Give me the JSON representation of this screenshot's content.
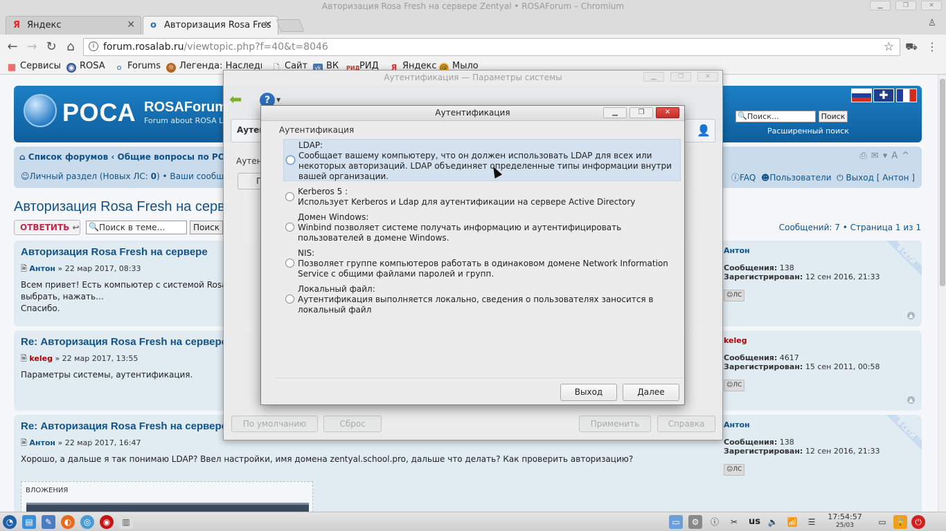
{
  "window": {
    "title": "Авторизация Rosa Fresh на сервере Zentyal • ROSAForum – Chromium"
  },
  "tabs": [
    {
      "label": "Яндекс",
      "favicon": "Я"
    },
    {
      "label": "Авторизация Rosa Fres",
      "favicon": "o"
    }
  ],
  "address": {
    "host": "forum.rosalab.ru",
    "path": "/viewtopic.php?f=40&t=8046"
  },
  "bookmarks": [
    {
      "label": "Сервисы",
      "icon": "apps-grid-icon"
    },
    {
      "label": "ROSA",
      "icon": "rosa-icon"
    },
    {
      "label": "Forums",
      "icon": "forums-icon"
    },
    {
      "label": "Легенда: Наследие",
      "icon": "game-icon"
    },
    {
      "label": "Сайт",
      "icon": "page-icon"
    },
    {
      "label": "ВК",
      "icon": "vk-icon"
    },
    {
      "label": "РИД",
      "icon": "rid-icon"
    },
    {
      "label": "Яндекс",
      "icon": "yandex-icon"
    },
    {
      "label": "Мыло",
      "icon": "mail-icon"
    }
  ],
  "forum": {
    "logo_text": "РОСА",
    "site_title": "ROSAForum",
    "site_desc": "Forum about ROSA L",
    "search_placeholder": "Поиск…",
    "search_button": "Поиск",
    "advanced_search": "Расширенный поиск",
    "breadcrumb_home": "Список форумов",
    "breadcrumb_sep": "‹",
    "breadcrumb_section": "Общие вопросы по РОСЕ",
    "personal_label": "Личный раздел (Новых ЛС: ",
    "personal_count": "0",
    "personal_close": ") • Ваши сообщен",
    "faq": "FAQ",
    "users": "Пользователи",
    "logout": "Выход [ Антон ]",
    "topic_title": "Авторизация Rosa Fresh на серве",
    "reply_button": "ОТВЕТИТЬ",
    "topic_search_placeholder": "Поиск в теме…",
    "topic_search_button": "Поиск",
    "pagination": "Сообщений: 7 • Страница 1 из 1",
    "attachments_label": "ВЛОЖЕНИЯ"
  },
  "posts": [
    {
      "title": "Авторизация Rosa Fresh на сервере",
      "author": "Антон",
      "date": " » 22 мар 2017, 08:33",
      "body": [
        "Всем привет! Есть компьютер с системой Rosa F",
        "выбрать, нажать…",
        "Спасибо."
      ],
      "profile_name": "Антон",
      "posts_label": "Сообщения:",
      "posts_count": "138",
      "reg_label": "Зарегистрирован:",
      "reg_date": "12 сен 2016, 21:33",
      "pm": "ЛС",
      "online": "В СЕТИ"
    },
    {
      "title": "Re: Авторизация Rosa Fresh на сервере",
      "author": "keleg",
      "date": " » 22 мар 2017, 13:55",
      "body": [
        "Параметры системы, аутентификация."
      ],
      "profile_name": "keleg",
      "posts_label": "Сообщения:",
      "posts_count": "4617",
      "reg_label": "Зарегистрирован:",
      "reg_date": "15 сен 2011, 00:58",
      "pm": "ЛС"
    },
    {
      "title": "Re: Авторизация Rosa Fresh на сервере",
      "author": "Антон",
      "date": " » 22 мар 2017, 16:47",
      "body": [
        "Хорошо, а дальше я так понимаю LDAP? Ввел настройки, имя домена zentyal.school.pro, дальше что делать? Как проверить авторизацию?"
      ],
      "profile_name": "Антон",
      "posts_label": "Сообщения:",
      "posts_count": "138",
      "reg_label": "Зарегистрирован:",
      "reg_date": "12 сен 2016, 21:33",
      "pm": "ЛС",
      "online": "В СЕТИ"
    }
  ],
  "parent_dialog": {
    "title": "Аутентификация — Параметры системы",
    "group_title": "Аутен",
    "section2": "Аутен",
    "section2_button": "П",
    "defaults_button": "По умолчанию",
    "reset_button": "Сброс",
    "apply_button": "Применить",
    "help_button": "Справка"
  },
  "auth_dialog": {
    "title": "Аутентификация",
    "group_label": "Аутентификация",
    "options": [
      {
        "title": "LDAP:",
        "desc": [
          "Сообщает вашему компьютеру, что он должен использовать LDAP для всех или",
          "некоторых авторизаций. LDAP объединяет определенные типы информации внутри",
          "вашей организации."
        ]
      },
      {
        "title": "Kerberos 5 :",
        "desc": [
          "Использует Kerberos и Ldap для аутентификации на сервере Active Directory"
        ]
      },
      {
        "title": "Домен Windows:",
        "desc": [
          "Winbind позволяет системе получать информацию и аутентифицировать",
          "пользователей в домене Windows."
        ]
      },
      {
        "title": "NIS:",
        "desc": [
          "Позволяет группе компьютеров работать в одинаковом домене Network Information",
          "Service с общими файлами паролей и групп."
        ]
      },
      {
        "title": "Локальный файл:",
        "desc": [
          "Аутентификация выполняется локально, сведения о пользователях заносится в",
          "локальный файл"
        ]
      }
    ],
    "selected_index": 0,
    "exit_button": "Выход",
    "next_button": "Далее"
  },
  "taskbar": {
    "keyboard_layout": "us",
    "time": "17:54:57",
    "date": "25/03"
  }
}
